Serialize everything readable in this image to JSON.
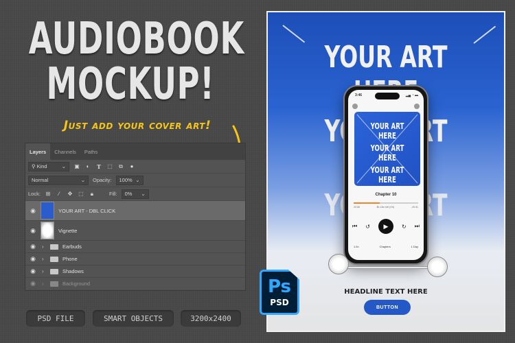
{
  "hero": {
    "title_line1": "AUDIOBOOK",
    "title_line2": "MOCKUP!",
    "tagline": "Just add your cover art!",
    "accent_color": "#f5c518"
  },
  "layers_panel": {
    "tabs": [
      {
        "label": "Layers",
        "active": true
      },
      {
        "label": "Channels",
        "active": false
      },
      {
        "label": "Paths",
        "active": false
      }
    ],
    "filter": {
      "label": "Kind",
      "icons": [
        "image-filter-icon",
        "adjustment-filter-icon",
        "type-filter-icon",
        "shape-filter-icon",
        "smart-object-filter-icon",
        "filter-toggle-icon"
      ]
    },
    "blend_mode": "Normal",
    "opacity_label": "Opacity:",
    "opacity_value": "100%",
    "lock_label": "Lock:",
    "fill_label": "Fill:",
    "fill_value": "0%",
    "layers": [
      {
        "name": "YOUR ART - DBL CLICK",
        "type": "smart-object",
        "visible": true,
        "selected": true
      },
      {
        "name": "Vignette",
        "type": "pixel",
        "visible": true,
        "selected": false
      },
      {
        "name": "Earbuds",
        "type": "group",
        "visible": true,
        "selected": false
      },
      {
        "name": "Phone",
        "type": "group",
        "visible": true,
        "selected": false
      },
      {
        "name": "Shadows",
        "type": "group",
        "visible": true,
        "selected": false
      },
      {
        "name": "Background",
        "type": "group",
        "visible": true,
        "selected": false
      }
    ]
  },
  "badges": [
    "PSD FILE",
    "SMART OBJECTS",
    "3200x2400"
  ],
  "poster": {
    "art_text": "YOUR ART HERE",
    "headline": "HEADLINE TEXT HERE",
    "button_label": "BUTTON",
    "brand_color": "#2358c6",
    "phone": {
      "status_time": "3:46",
      "status_icons": "▂▄ ◔ ▬",
      "cover_text": "YOUR ART HERE",
      "chapter": "Chapter 10",
      "progress": 0.4,
      "time_elapsed": "20:28",
      "time_left": "8h 13m left (1%)",
      "time_remaining": "-20:31",
      "skip_back": "30",
      "skip_forward": "30",
      "speed": "1.5×",
      "chapters_label": "Chapters",
      "sleep_label": "1 Day"
    }
  },
  "ps_badge": {
    "mark": "Ps",
    "label": "PSD",
    "color": "#31a8ff"
  }
}
